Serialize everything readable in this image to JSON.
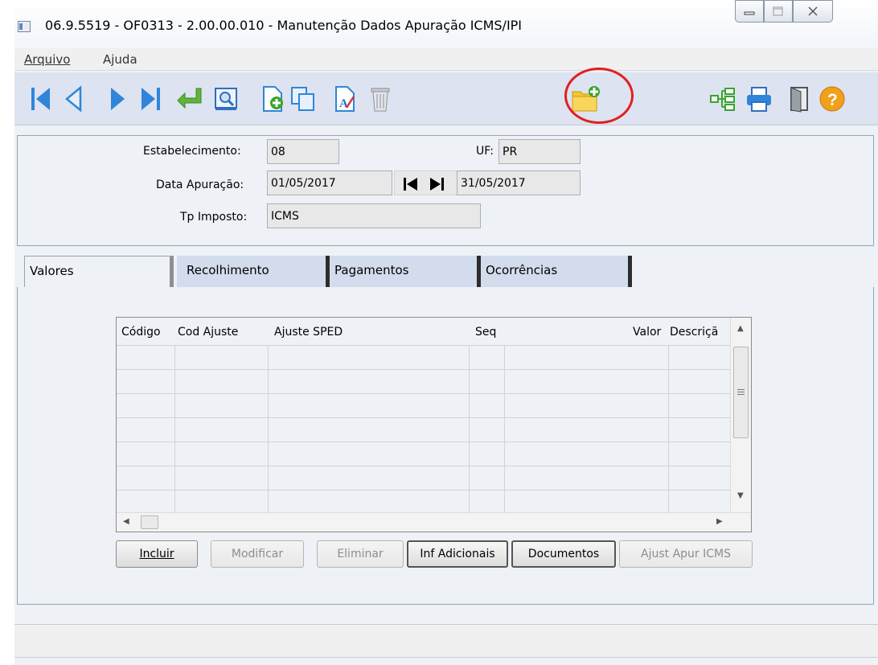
{
  "window": {
    "title": "06.9.5519 - OF0313 - 2.00.00.010 - Manutenção Dados Apuração ICMS/IPI",
    "controls": {
      "minimize": "—",
      "maximize": "□",
      "close": "✕"
    }
  },
  "menu": {
    "items": [
      {
        "label": "Arquivo"
      },
      {
        "label": "Ajuda"
      }
    ]
  },
  "toolbar": {
    "icons": [
      "first-record-icon",
      "previous-record-icon",
      "next-record-icon",
      "last-record-icon",
      "goto-icon",
      "search-icon",
      "add-icon",
      "copy-icon",
      "edit-icon",
      "delete-icon",
      "new-folder-icon",
      "tree-icon",
      "print-icon",
      "exit-icon",
      "help-icon"
    ],
    "highlighted": "new-folder-icon"
  },
  "header": {
    "estabelecimento_label": "Estabelecimento:",
    "estabelecimento_value": "08",
    "uf_label": "UF:",
    "uf_value": "PR",
    "data_label": "Data Apuração:",
    "data_inicio": "01/05/2017",
    "data_fim": "31/05/2017",
    "tp_imposto_label": "Tp Imposto:",
    "tp_imposto_value": "ICMS"
  },
  "tabs": [
    {
      "label": "Valores",
      "active": true
    },
    {
      "label": "Recolhimento",
      "active": false
    },
    {
      "label": "Pagamentos",
      "active": false
    },
    {
      "label": "Ocorrências",
      "active": false
    }
  ],
  "grid": {
    "columns": [
      "Código",
      "Cod Ajuste",
      "Ajuste SPED",
      "Seq",
      "Valor",
      "Descriçã"
    ],
    "rows": []
  },
  "buttons": {
    "incluir": "Incluir",
    "modificar": "Modificar",
    "eliminar": "Eliminar",
    "inf_adicionais": "Inf Adicionais",
    "documentos": "Documentos",
    "ajust_apur": "Ajust Apur ICMS"
  },
  "colors": {
    "toolbar_bg": "#dde3f0",
    "highlight_circle": "#e02020",
    "icon_blue": "#2f86d8",
    "icon_green": "#3aa52d"
  }
}
